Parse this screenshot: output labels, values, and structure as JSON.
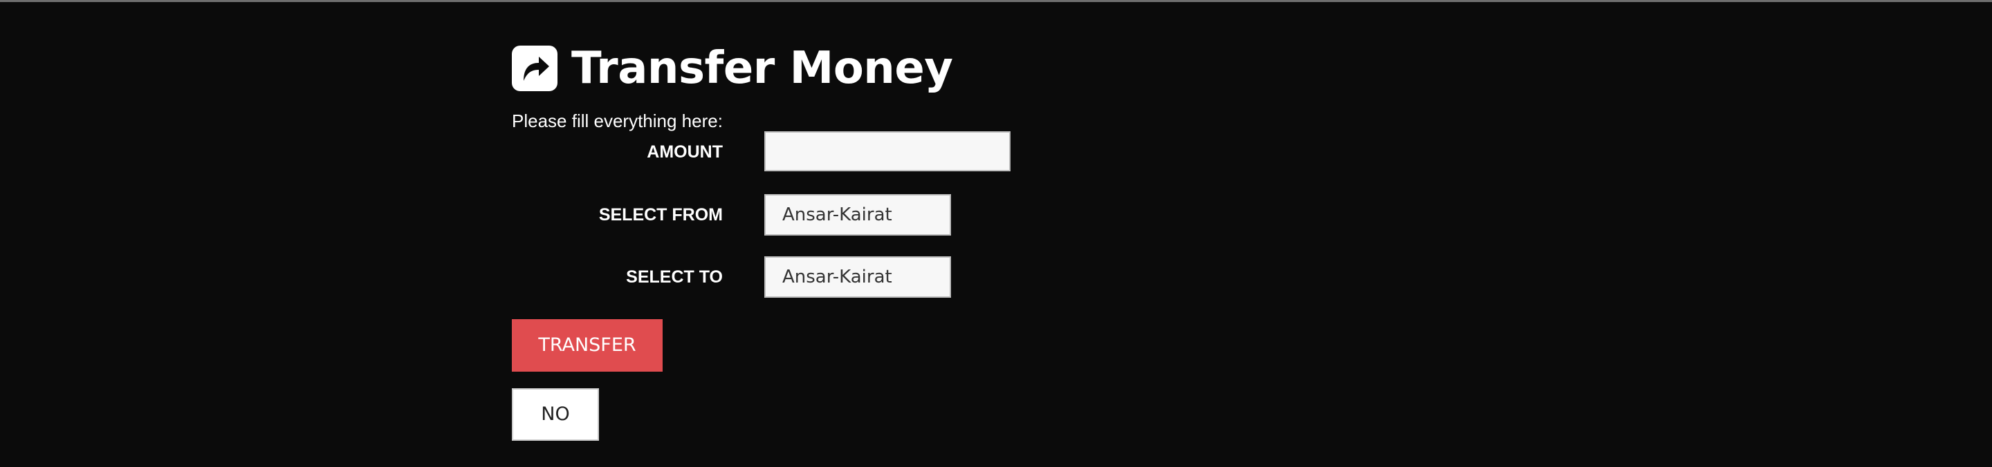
{
  "page": {
    "title": "Transfer Money",
    "title_icon": "share-forward-icon",
    "instructions": "Please fill everything here:"
  },
  "form": {
    "amount": {
      "label": "AMOUNT",
      "value": "",
      "placeholder": ""
    },
    "select_from": {
      "label": "SELECT FROM",
      "selected": "Ansar-Kairat"
    },
    "select_to": {
      "label": "SELECT TO",
      "selected": "Ansar-Kairat"
    }
  },
  "buttons": {
    "transfer": "TRANSFER",
    "no": "NO"
  },
  "colors": {
    "background": "#0b0b0b",
    "transfer_button": "#e04c4f",
    "input_background": "#f7f7f7"
  }
}
